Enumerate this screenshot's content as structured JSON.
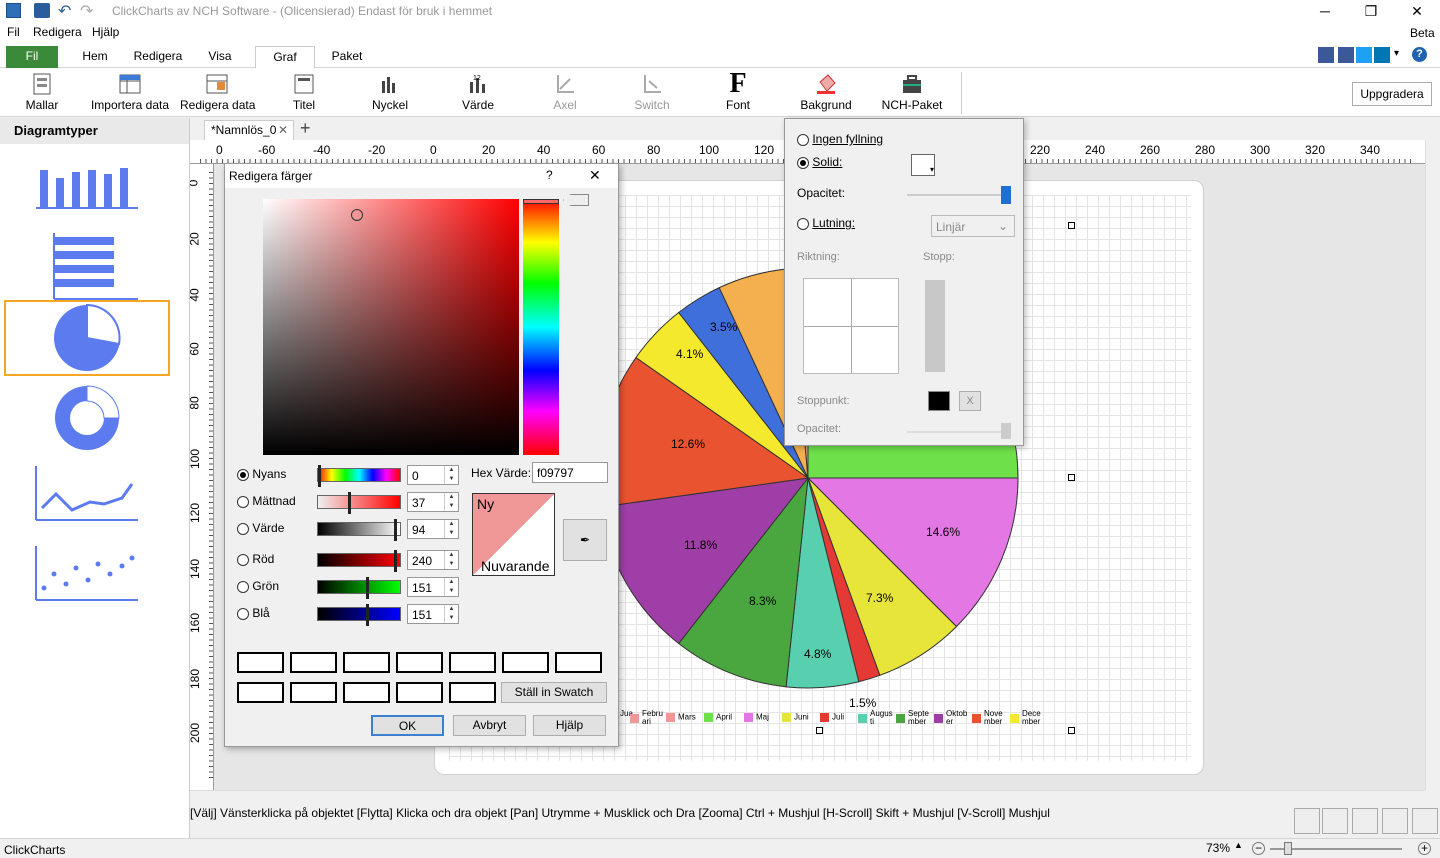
{
  "window": {
    "title": "ClickCharts av NCH Software - (Olicensierad) Endast för bruk i hemmet",
    "minimize": "─",
    "maximize": "❐",
    "close": "✕"
  },
  "menu": {
    "items": [
      "Fil",
      "Redigera",
      "Hjälp"
    ]
  },
  "ribbon_tabs": [
    "Fil",
    "Hem",
    "Redigera",
    "Visa",
    "Graf",
    "Paket"
  ],
  "beta": "Beta",
  "ribbon": {
    "buttons": [
      "Mallar",
      "Importera data",
      "Redigera data",
      "Titel",
      "Nyckel",
      "Värde",
      "Axel",
      "Switch",
      "Font",
      "Bakgrund",
      "NCH-Paket"
    ],
    "upgrade": "Uppgradera"
  },
  "sidebar": {
    "title": "Diagramtyper"
  },
  "doc_tab": {
    "name": "*Namnlös_0",
    "close": "✕",
    "add": "+"
  },
  "ruler_h": [
    "0",
    "-60",
    "-40",
    "-20",
    "0",
    "20",
    "40",
    "60",
    "80",
    "100",
    "120",
    "220",
    "240",
    "260",
    "280",
    "300",
    "320",
    "340"
  ],
  "ruler_v": [
    "0",
    "20",
    "40",
    "60",
    "80",
    "100",
    "120",
    "140",
    "160",
    "180",
    "200"
  ],
  "chart_data": {
    "type": "pie",
    "labels": [
      "3.5%",
      "4.1%",
      "12.6%",
      "11.8%",
      "8.3%",
      "4.8%",
      "1.5%",
      "7.3%",
      "14.6%"
    ],
    "legend": [
      "Jua",
      "Febru ari",
      "Mars",
      "April",
      "Maj",
      "Juni",
      "Juli",
      "Augus ti",
      "Septe mber",
      "Oktob er",
      "Nove mber",
      "Dece mber"
    ],
    "colors": [
      "#f4b04e",
      "#3f6fdb",
      "#f5e92e",
      "#ea5330",
      "#a03ea8",
      "#4aa63e",
      "#58d0b0",
      "#e53935",
      "#e7e53a",
      "#e377e3",
      "#6ee04a",
      "#f09797"
    ]
  },
  "color_dialog": {
    "title": "Redigera färger",
    "help": "?",
    "close": "✕",
    "hex_label": "Hex Värde:",
    "hex_value": "f09797",
    "new_label": "Ny",
    "current_label": "Nuvarande",
    "channels": [
      {
        "label": "Nyans",
        "value": "0",
        "level": 0
      },
      {
        "label": "Mättnad",
        "value": "37",
        "level": 0.37
      },
      {
        "label": "Värde",
        "value": "94",
        "level": 0.94
      },
      {
        "label": "Röd",
        "value": "240",
        "level": 0.94
      },
      {
        "label": "Grön",
        "value": "151",
        "level": 0.59
      },
      {
        "label": "Blå",
        "value": "151",
        "level": 0.59
      }
    ],
    "set_swatch": "Ställ in Swatch",
    "ok": "OK",
    "cancel": "Avbryt",
    "helpbtn": "Hjälp"
  },
  "fill_panel": {
    "no_fill": "Ingen fyllning",
    "solid": "Solid:",
    "opacity": "Opacitet:",
    "gradient": "Lutning:",
    "gradient_type": "Linjär",
    "direction": "Riktning:",
    "stops": "Stopp:",
    "stoppoint": "Stoppunkt:",
    "opacity2": "Opacitet:",
    "x": "X"
  },
  "status": "[Välj] Vänsterklicka på objektet [Flytta] Klicka och dra objekt [Pan] Utrymme + Musklick och Dra [Zooma] Ctrl + Mushjul [H-Scroll] Skift + Mushjul [V-Scroll] Mushjul",
  "bottom": {
    "app": "ClickCharts",
    "zoom": "73%"
  }
}
